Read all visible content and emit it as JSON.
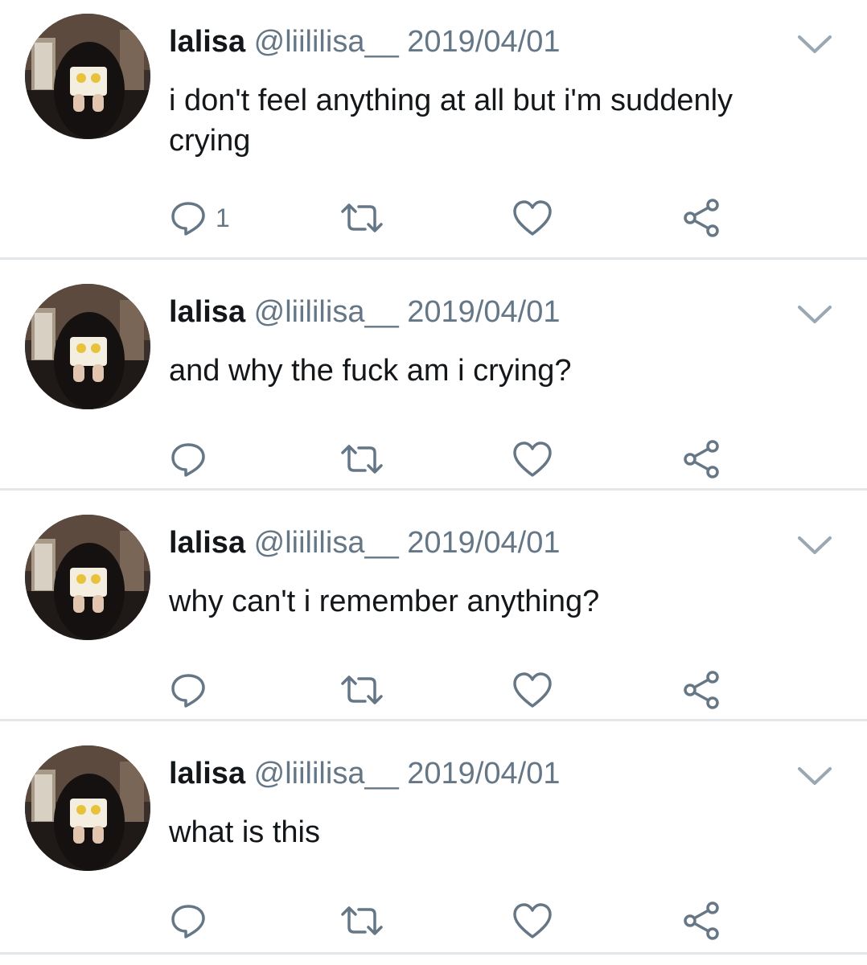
{
  "tweets": [
    {
      "name": "lalisa",
      "handle": "@liililisa__",
      "date": "2019/04/01",
      "text": "i don't feel anything at all but i'm suddenly crying",
      "reply_count": "1"
    },
    {
      "name": "lalisa",
      "handle": "@liililisa__",
      "date": "2019/04/01",
      "text": "and why the fuck am i crying?",
      "reply_count": ""
    },
    {
      "name": "lalisa",
      "handle": "@liililisa__",
      "date": "2019/04/01",
      "text": "why can't i remember anything?",
      "reply_count": ""
    },
    {
      "name": "lalisa",
      "handle": "@liililisa__",
      "date": "2019/04/01",
      "text": "what is this",
      "reply_count": ""
    }
  ],
  "icons": {
    "reply": "reply-icon",
    "retweet": "retweet-icon",
    "like": "heart-icon",
    "share": "share-icon",
    "caret": "chevron-down-icon"
  },
  "colors": {
    "text": "#14171a",
    "secondary": "#657786",
    "divider": "#e3e7ea"
  }
}
